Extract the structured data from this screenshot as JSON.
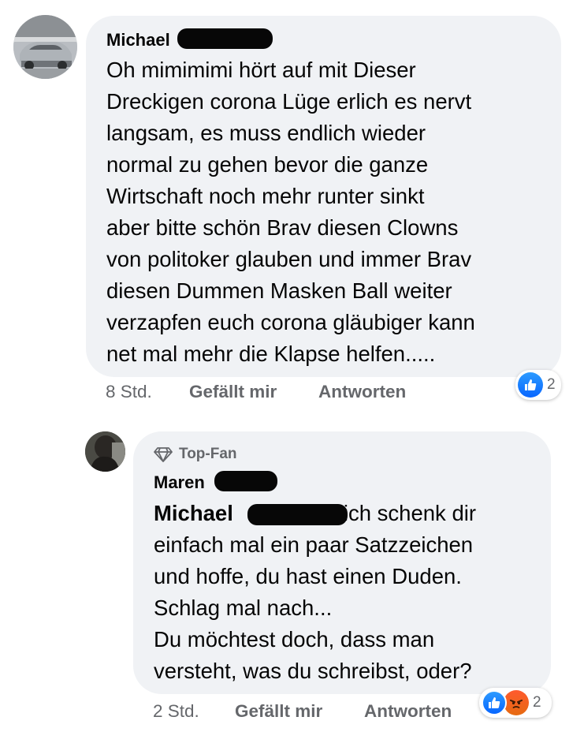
{
  "comment": {
    "author": "Michael",
    "body_lines": [
      "Oh mimimimi hört auf mit Dieser",
      "Dreckigen corona Lüge erlich es nervt",
      "langsam, es muss endlich wieder",
      "normal zu gehen bevor die ganze",
      "Wirtschaft noch mehr runter sinkt",
      "aber bitte schön Brav diesen Clowns",
      "von politoker glauben und immer Brav",
      "diesen Dummen Masken Ball weiter",
      "verzapfen euch corona gläubiger kann",
      "net mal mehr die Klapse helfen....."
    ],
    "time": "8 Std.",
    "like_label": "Gefällt mir",
    "reply_label": "Antworten",
    "reaction_count": "2",
    "reaction_icons": [
      "like-icon"
    ]
  },
  "reply": {
    "badge": "Top-Fan",
    "badge_icon": "diamond-icon",
    "author": "Maren",
    "mention": "Michael",
    "first_line_rest": "ich schenk dir",
    "body_lines": [
      "einfach mal ein paar Satzzeichen",
      "und hoffe, du hast einen Duden.",
      "Schlag mal nach...",
      "Du möchtest doch, dass man",
      "versteht, was du schreibst, oder?"
    ],
    "time": "2 Std.",
    "like_label": "Gefällt mir",
    "reply_label": "Antworten",
    "reaction_count": "2",
    "reaction_icons": [
      "like-icon",
      "angry-icon"
    ]
  },
  "colors": {
    "bubble_bg": "#f0f2f5",
    "meta_text": "#65676b",
    "like_blue": "#0866ff",
    "angry_orange": "#ff5a2e"
  }
}
